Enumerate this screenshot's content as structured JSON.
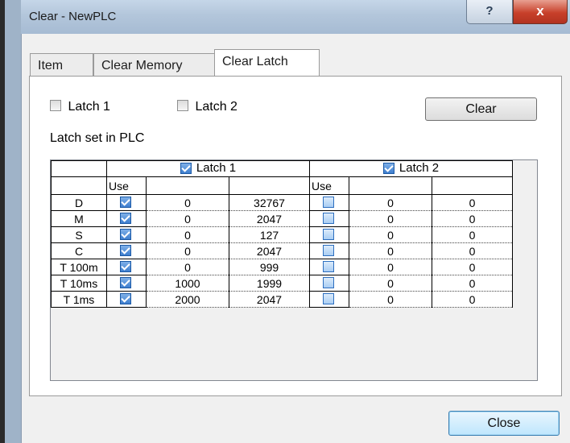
{
  "window": {
    "title": "Clear - NewPLC",
    "help_label": "?",
    "close_x_label": "x"
  },
  "tabs": [
    {
      "label": "Item",
      "active": false
    },
    {
      "label": "Clear Memory",
      "active": false
    },
    {
      "label": "Clear Latch",
      "active": true
    }
  ],
  "options": {
    "latch1_label": "Latch 1",
    "latch1_checked": false,
    "latch2_label": "Latch 2",
    "latch2_checked": false,
    "clear_button": "Clear",
    "section_label": "Latch set in  PLC"
  },
  "grid": {
    "groups": [
      {
        "label": "Latch 1",
        "checked": true
      },
      {
        "label": "Latch 2",
        "checked": true
      }
    ],
    "use_label": "Use",
    "rows": [
      {
        "device": "D",
        "l1_use": true,
        "l1_start": "0",
        "l1_end": "32767",
        "l2_use": false,
        "l2_start": "0",
        "l2_end": "0"
      },
      {
        "device": "M",
        "l1_use": true,
        "l1_start": "0",
        "l1_end": "2047",
        "l2_use": false,
        "l2_start": "0",
        "l2_end": "0"
      },
      {
        "device": "S",
        "l1_use": true,
        "l1_start": "0",
        "l1_end": "127",
        "l2_use": false,
        "l2_start": "0",
        "l2_end": "0"
      },
      {
        "device": "C",
        "l1_use": true,
        "l1_start": "0",
        "l1_end": "2047",
        "l2_use": false,
        "l2_start": "0",
        "l2_end": "0"
      },
      {
        "device": "T 100m",
        "l1_use": true,
        "l1_start": "0",
        "l1_end": "999",
        "l2_use": false,
        "l2_start": "0",
        "l2_end": "0"
      },
      {
        "device": "T 10ms",
        "l1_use": true,
        "l1_start": "1000",
        "l1_end": "1999",
        "l2_use": false,
        "l2_start": "0",
        "l2_end": "0"
      },
      {
        "device": "T 1ms",
        "l1_use": true,
        "l1_start": "2000",
        "l1_end": "2047",
        "l2_use": false,
        "l2_start": "0",
        "l2_end": "0"
      }
    ]
  },
  "footer": {
    "close_button": "Close"
  }
}
